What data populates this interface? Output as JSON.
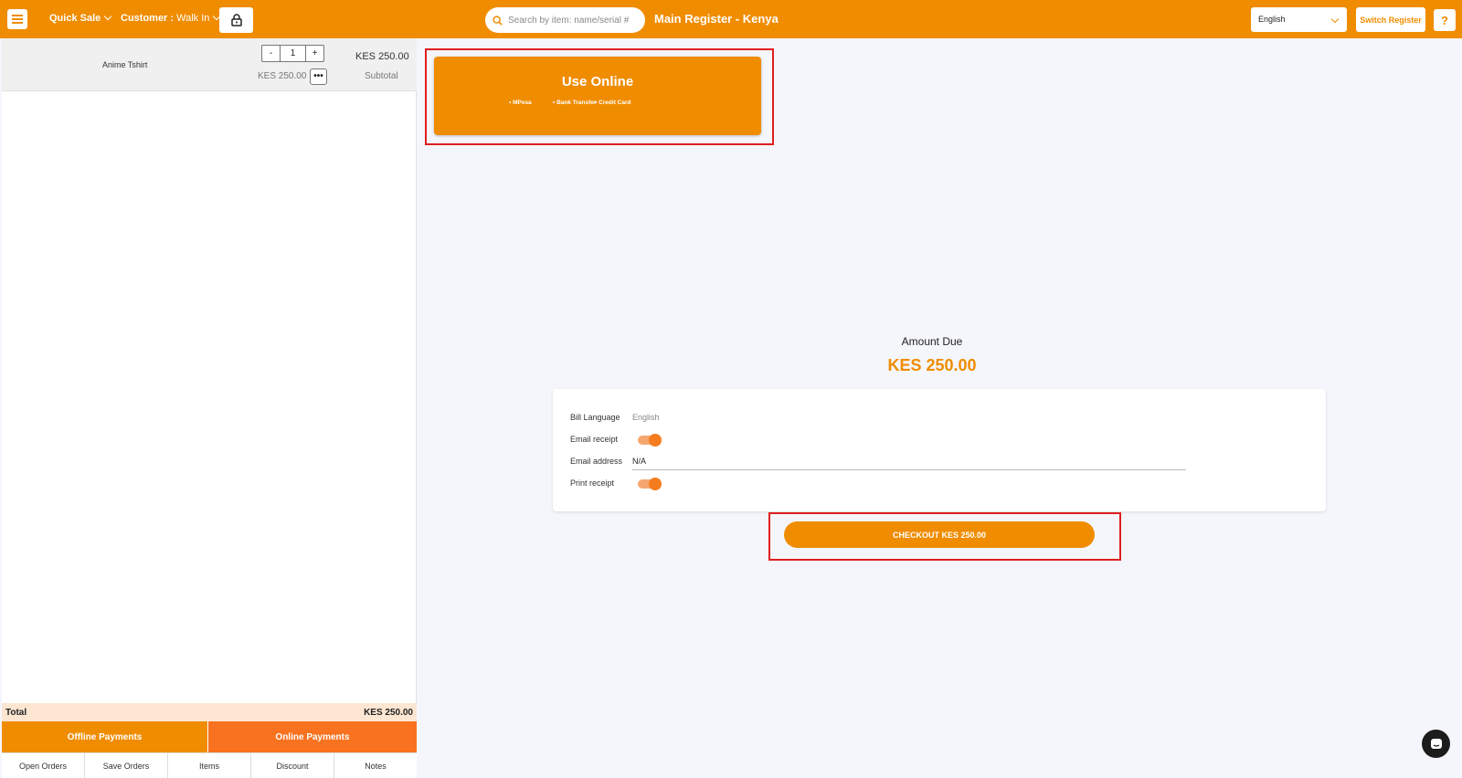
{
  "topbar": {
    "quick_sale_label": "Quick Sale",
    "customer_label": "Customer :",
    "customer_value": "Walk In",
    "search_placeholder": "Search by item: name/serial #",
    "register_title": "Main Register - Kenya",
    "language_value": "English",
    "switch_register_label": "Switch Register",
    "help_label": "?",
    "brand_color": "#f08c00"
  },
  "cart": {
    "items": [
      {
        "name": "Anime Tshirt",
        "qty_minus": "-",
        "qty_value": "1",
        "qty_plus": "+",
        "unit_price": "KES 250.00",
        "more_label": "•••",
        "line_total": "KES 250.00",
        "subtotal_label": "Subtotal"
      }
    ],
    "total_label": "Total",
    "total_value": "KES 250.00",
    "offline_payments_label": "Offline Payments",
    "online_payments_label": "Online Payments",
    "tabs": [
      "Open Orders",
      "Save Orders",
      "Items",
      "Discount",
      "Notes"
    ]
  },
  "online_card": {
    "title": "Use Online",
    "methods": [
      "• MPesa",
      "• Bank Transfer",
      "• Credit Card"
    ]
  },
  "amount_due": {
    "label": "Amount Due",
    "value": "KES 250.00"
  },
  "receipt": {
    "bill_language_label": "Bill Language",
    "bill_language_value": "English",
    "email_receipt_label": "Email receipt",
    "email_receipt_on": true,
    "email_address_label": "Email address",
    "email_address_value": "N/A",
    "print_receipt_label": "Print receipt",
    "print_receipt_on": true
  },
  "checkout_label": "CHECKOUT KES 250.00",
  "icons": [
    "menu-icon",
    "chevron-down-icon",
    "lock-icon",
    "search-icon",
    "chat-icon"
  ]
}
